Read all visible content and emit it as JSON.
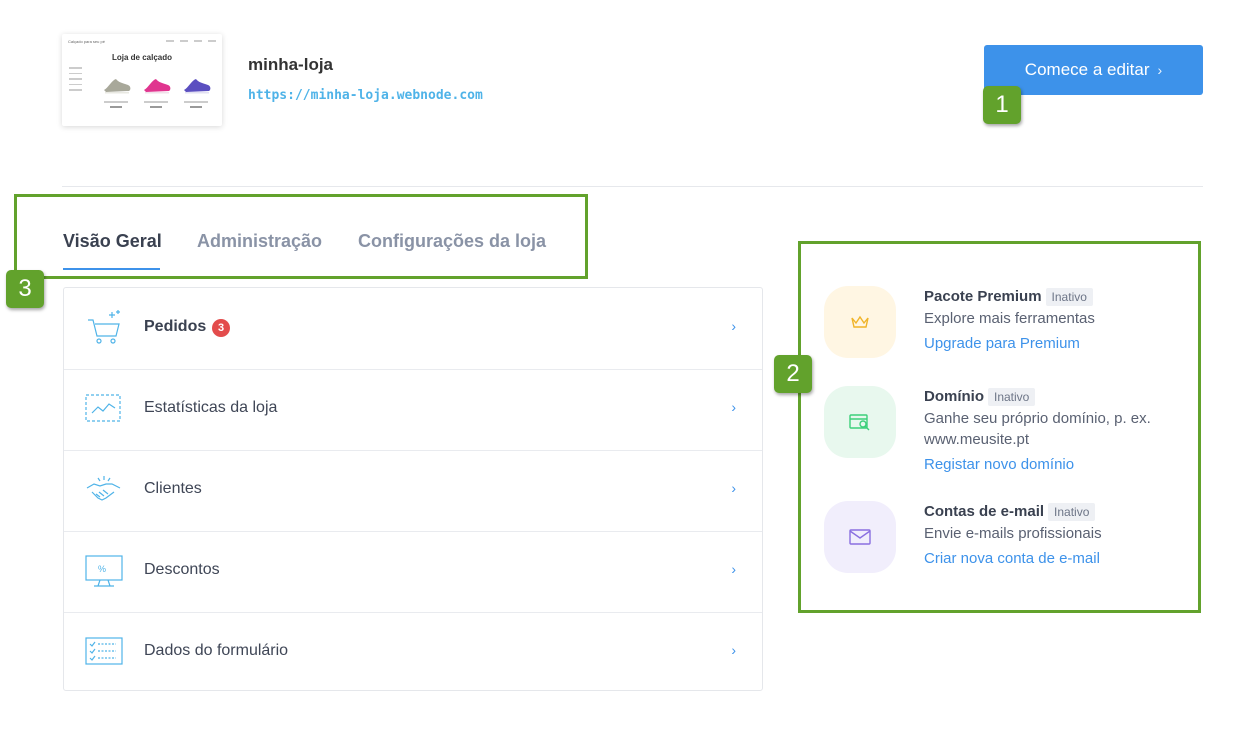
{
  "site": {
    "name": "minha-loja",
    "url": "https://minha-loja.webnode.com",
    "preview": {
      "brand": "Calçado para seu pé",
      "title": "Loja de calçado",
      "shoe_colors": [
        "#a8a89a",
        "#e0358f",
        "#5b4fc0"
      ]
    }
  },
  "header": {
    "edit_button": "Comece a editar",
    "edit_chevron": "›"
  },
  "tabs": [
    {
      "label": "Visão Geral",
      "active": true
    },
    {
      "label": "Administração",
      "active": false
    },
    {
      "label": "Configurações da loja",
      "active": false
    }
  ],
  "menu": [
    {
      "label": "Pedidos",
      "badge": "3",
      "icon": "cart-icon"
    },
    {
      "label": "Estatísticas da loja",
      "icon": "chart-icon"
    },
    {
      "label": "Clientes",
      "icon": "handshake-icon"
    },
    {
      "label": "Descontos",
      "icon": "discount-monitor-icon"
    },
    {
      "label": "Dados do formulário",
      "icon": "form-list-icon"
    }
  ],
  "arrow": "›",
  "services": [
    {
      "title": "Pacote Premium",
      "status": "Inativo",
      "description": "Explore mais ferramentas",
      "link": "Upgrade para Premium",
      "icon": "crown-icon",
      "bg": "#fff6e3",
      "color": "#f0b429"
    },
    {
      "title": "Domínio",
      "status": "Inativo",
      "description": "Ganhe seu próprio domínio, p. ex. www.meusite.pt",
      "link": "Registar novo domínio",
      "icon": "domain-search-icon",
      "bg": "#e8f8ee",
      "color": "#3ccf7a"
    },
    {
      "title": "Contas de e-mail",
      "status": "Inativo",
      "description": "Envie e-mails profissionais",
      "link": "Criar nova conta de e-mail",
      "icon": "envelope-icon",
      "bg": "#f1eefc",
      "color": "#8a6fe0"
    }
  ],
  "annotations": [
    "1",
    "2",
    "3"
  ],
  "colors": {
    "accent": "#3d92ea",
    "annotation": "#62a22c",
    "badge": "#e34c4c"
  }
}
